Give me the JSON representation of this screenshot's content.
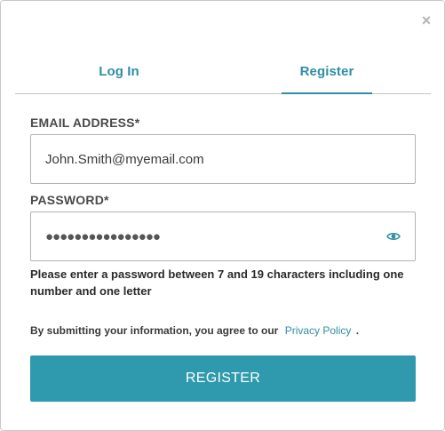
{
  "close_glyph": "×",
  "tabs": [
    {
      "label": "Log In",
      "active": false
    },
    {
      "label": "Register",
      "active": true
    }
  ],
  "email": {
    "label": "EMAIL ADDRESS*",
    "value": "John.Smith@myemail.com"
  },
  "password": {
    "label": "PASSWORD*",
    "masked_value": "●●●●●●●●●●●●●●●●",
    "toggle_icon": "eye-icon"
  },
  "password_hint": "Please enter a password between 7 and 19 characters including one number and one letter",
  "agreement": {
    "text": "By submitting your information, you agree to our",
    "link": "Privacy Policy",
    "suffix": "."
  },
  "submit_label": "REGISTER",
  "colors": {
    "accent": "#2f9aad",
    "link": "#2e8fa4"
  }
}
